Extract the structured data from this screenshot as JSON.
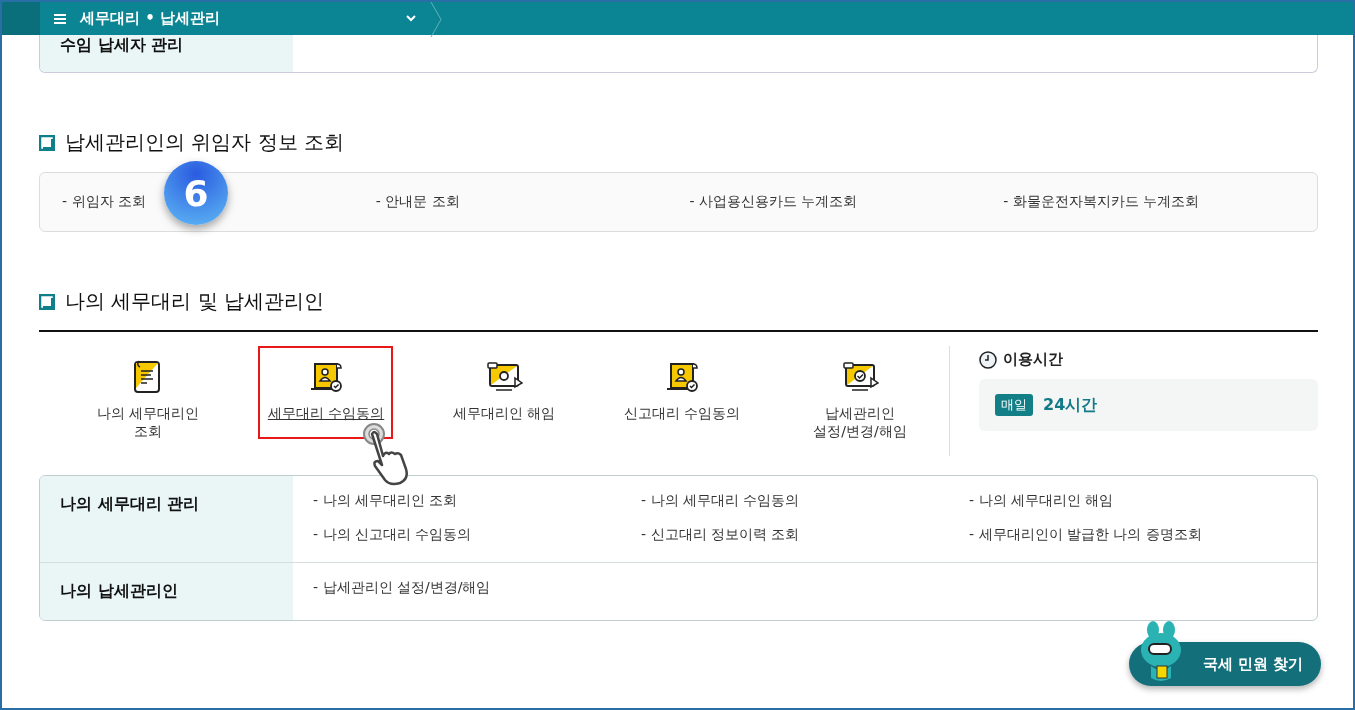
{
  "breadcrumb": {
    "title": "세무대리 • 납세관리"
  },
  "top_card": {
    "label": "수임 납세자 관리"
  },
  "delegator_section": {
    "title": "납세관리인의 위임자 정보 조회",
    "links": [
      "- 위임자 조회",
      "- 안내문 조회",
      "- 사업용신용카드 누계조회",
      "- 화물운전자복지카드 누계조회"
    ],
    "step_badge": "6"
  },
  "agent_section": {
    "title": "나의 세무대리 및 납세관리인",
    "services": [
      {
        "label": "나의 세무대리인\n조회",
        "kind": "notepad",
        "selected": false
      },
      {
        "label": "세무대리 수임동의",
        "kind": "scroll",
        "selected": true
      },
      {
        "label": "세무대리인 해임",
        "kind": "screen",
        "selected": false
      },
      {
        "label": "신고대리 수임동의",
        "kind": "scroll",
        "selected": false
      },
      {
        "label": "납세관리인\n설정/변경/해임",
        "kind": "monitor",
        "selected": false
      }
    ],
    "hours": {
      "title": "이용시간",
      "badge": "매일",
      "value": "24시간"
    }
  },
  "menu_table": [
    {
      "heading": "나의 세무대리 관리",
      "links": [
        "- 나의 세무대리인 조회",
        "- 나의 세무대리 수임동의",
        "- 나의 세무대리인 해임",
        "- 나의 신고대리 수임동의",
        "- 신고대리 정보이력 조회",
        "- 세무대리인이 발급한 나의 증명조회"
      ]
    },
    {
      "heading": "나의 납세관리인",
      "links": [
        "- 납세관리인 설정/변경/해임"
      ]
    }
  ],
  "floating_button": {
    "label": "국세 민원 찾기"
  }
}
